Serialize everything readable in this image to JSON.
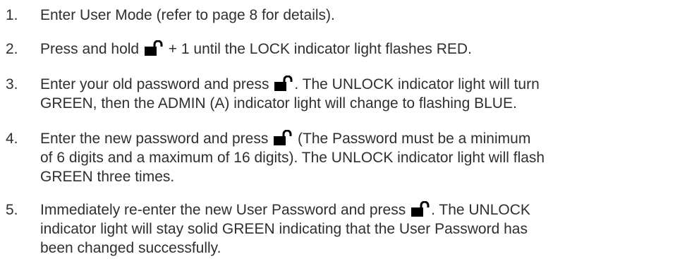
{
  "steps": [
    {
      "number": "1.",
      "text": "Enter User Mode (refer to page 8 for details)."
    },
    {
      "number": "2.",
      "before_icon": "Press and hold",
      "icon": "unlock-icon",
      "after_icon": "+ 1 until the LOCK indicator light flashes RED."
    },
    {
      "number": "3.",
      "before_icon": "Enter your old password and press",
      "icon": "unlock-icon",
      "after_icon": ". The UNLOCK indicator light will turn",
      "line2": "GREEN, then the ADMIN (A) indicator light will change to flashing BLUE."
    },
    {
      "number": "4.",
      "before_icon": "Enter the new password and press",
      "icon": "unlock-icon",
      "after_icon": "(The Password must be a minimum",
      "line2": "of 6 digits and a maximum of 16 digits). The UNLOCK indicator light will flash",
      "line3": "GREEN three times."
    },
    {
      "number": "5.",
      "before_icon": "Immediately re-enter the new User Password and press",
      "icon": "unlock-icon",
      "after_icon": ". The UNLOCK",
      "line2": "indicator light will stay solid GREEN indicating that the User Password has",
      "line3": "been changed successfully."
    }
  ]
}
